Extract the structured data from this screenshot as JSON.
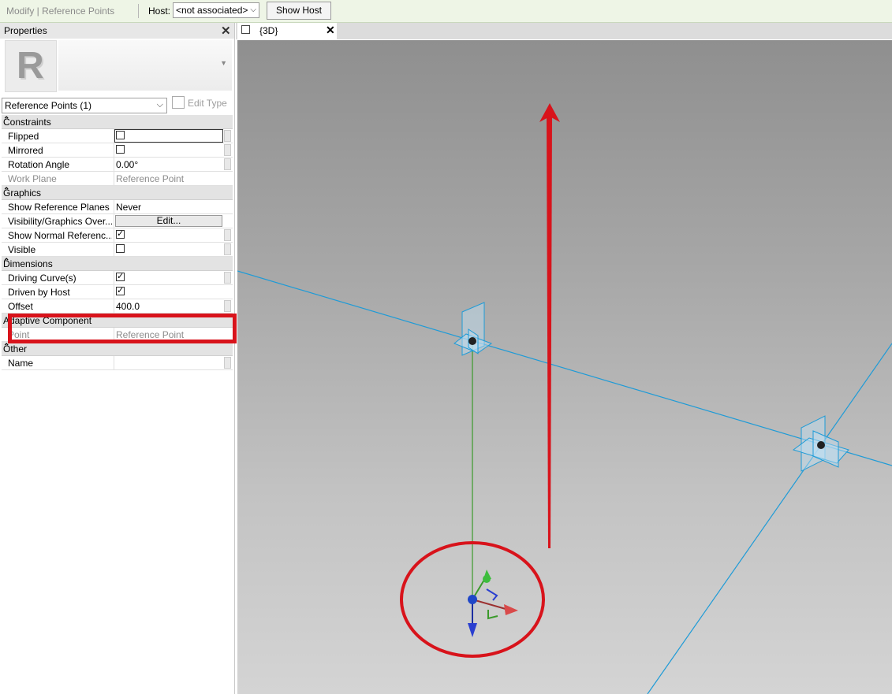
{
  "options_bar": {
    "context_label": "Modify | Reference Points",
    "host_label": "Host:",
    "host_value": "<not associated>",
    "show_host_button": "Show Host"
  },
  "properties": {
    "title": "Properties",
    "selector": "Reference Points (1)",
    "edit_type": "Edit Type",
    "groups": {
      "constraints": "Constraints",
      "graphics": "Graphics",
      "dimensions": "Dimensions",
      "adaptive": "Adaptive Component",
      "other": "Other"
    },
    "rows": {
      "flipped": "Flipped",
      "mirrored": "Mirrored",
      "rotation_angle": "Rotation Angle",
      "rotation_angle_value": "0.00°",
      "work_plane": "Work Plane",
      "work_plane_value": "Reference Point",
      "show_ref_planes": "Show Reference Planes",
      "show_ref_planes_value": "Never",
      "vis_graphics": "Visibility/Graphics Over...",
      "vis_graphics_value": "Edit...",
      "show_normal": "Show Normal Referenc...",
      "visible": "Visible",
      "driving_curves": "Driving Curve(s)",
      "driven_by_host": "Driven by Host",
      "offset": "Offset",
      "offset_value": "400.0",
      "point": "Point",
      "point_value": "Reference Point",
      "name": "Name"
    },
    "checkboxes": {
      "flipped": false,
      "mirrored": false,
      "show_normal": true,
      "visible": false,
      "driving_curves": true,
      "driven_by_host": true
    }
  },
  "view_tab": {
    "label": "{3D}"
  },
  "colors": {
    "annotation_red": "#d8131b",
    "reference_line": "#1e9bd7",
    "hosted_line": "#3a9a2a",
    "options_bar_bg": "#eef5e6"
  }
}
